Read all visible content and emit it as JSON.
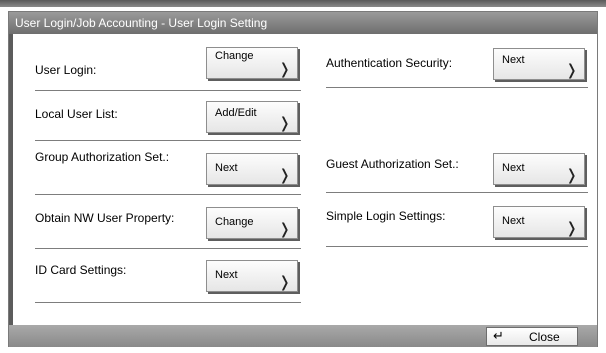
{
  "window": {
    "title": "User Login/Job Accounting - User Login Setting"
  },
  "settings": [
    {
      "label": "User Login:",
      "button": "Change"
    },
    {
      "label": "Local User List:",
      "button": "Add/Edit"
    },
    {
      "label": "Group Authorization Set.:",
      "button": "Next"
    },
    {
      "label": "Obtain NW User Property:",
      "button": "Change"
    },
    {
      "label": "ID Card Settings:",
      "button": "Next"
    },
    {
      "label": "Authentication Security:",
      "button": "Next"
    },
    {
      "label": "Guest Authorization Set.:",
      "button": "Next"
    },
    {
      "label": "Simple Login Settings:",
      "button": "Next"
    }
  ],
  "footer": {
    "close_label": "Close"
  },
  "icons": {
    "button_arrow": "chevron-right-icon",
    "close": "return-arrow-icon"
  }
}
